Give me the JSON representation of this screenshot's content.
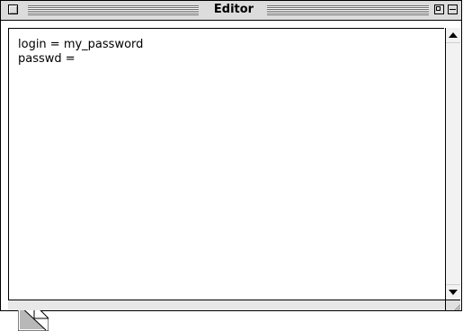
{
  "window": {
    "title": "Editor"
  },
  "editor": {
    "lines": [
      "login = my_password",
      "passwd ="
    ]
  },
  "icons": {
    "close": "close-box-icon",
    "zoom": "zoom-box-icon",
    "collapse": "collapse-box-icon",
    "scroll_up": "scroll-up-arrow-icon",
    "scroll_down": "scroll-down-arrow-icon",
    "page_curl": "page-curl-icon",
    "grow": "resize-grip-icon"
  }
}
